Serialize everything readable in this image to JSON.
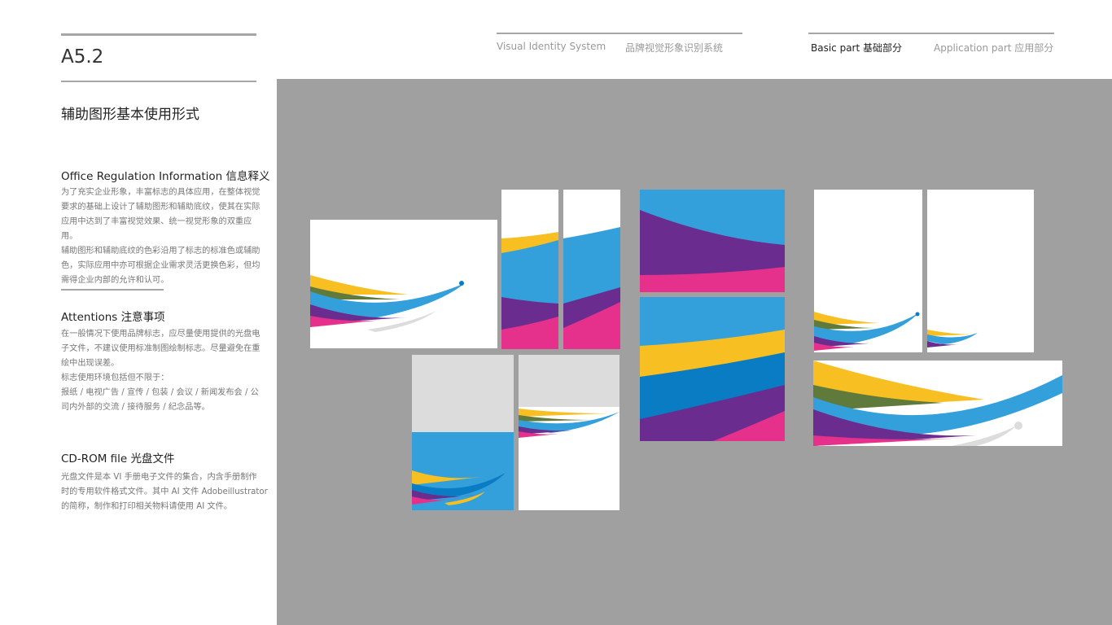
{
  "header": {
    "code": "A5.2",
    "title": "辅助图形基本使用形式",
    "nav": {
      "vis_en": "Visual Identity System",
      "vis_cn": "品牌视觉形象识别系统",
      "basic": "Basic part  基础部分",
      "application": "Application part  应用部分"
    }
  },
  "sections": [
    {
      "heading": "Office Regulation Information 信息释义",
      "lines": [
        "为了充实企业形象，丰富标志的具体应用，在整体视觉",
        "要求的基础上设计了辅助图形和辅助底纹，使其在实际",
        "应用中达到了丰富视觉效果、统一视觉形象的双重应用。",
        "辅助图形和辅助底纹的色彩沿用了标志的标准色或辅助",
        "色，实际应用中亦可根据企业需求灵活更换色彩，但均",
        "需得企业内部的允许和认可。"
      ]
    },
    {
      "heading": "Attentions 注意事项",
      "lines": [
        "在一般情况下使用品牌标志，应尽量使用提供的光盘电",
        "子文件，不建议使用标准制图绘制标志。尽量避免在重",
        "绘中出现误差。",
        "标志使用环境包括但不限于：",
        "报纸 / 电视广告 / 宣传 / 包装 / 会议 / 新闻发布会 / 公",
        "司内外部的交流 / 接待服务 / 纪念品等。"
      ]
    },
    {
      "heading": "CD-ROM file 光盘文件",
      "lines": [
        "光盘文件是本 VI 手册电子文件的集合，内含手册制作",
        "时的专用软件格式文件。其中 AI 文件 Adobeillustrator",
        "的简称，制作和打印相关物料请使用 AI 文件。"
      ]
    }
  ],
  "colors": {
    "yellow": "#f7bf22",
    "olive": "#5f7a3a",
    "blue": "#34a0db",
    "darkblue": "#0a7cc4",
    "purple": "#6a2c8e",
    "pink": "#e5318b",
    "lightgray": "#dcdcdc",
    "background": "#a0a0a0"
  }
}
